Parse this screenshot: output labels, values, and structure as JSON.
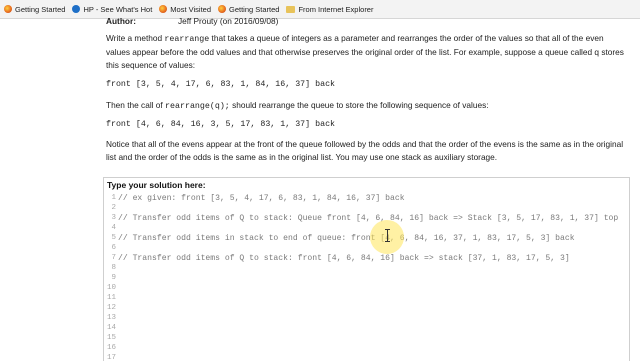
{
  "bookmarks": [
    {
      "label": "Getting Started",
      "icon": "firefox-icon"
    },
    {
      "label": "HP - See What's Hot",
      "icon": "hp-icon"
    },
    {
      "label": "Most Visited",
      "icon": "most-visited-icon"
    },
    {
      "label": "Getting Started",
      "icon": "firefox-icon"
    },
    {
      "label": "From Internet Explorer",
      "icon": "folder-icon"
    }
  ],
  "author": {
    "label": "Author:",
    "value": "Jeff Prouty (on 2016/09/08)"
  },
  "problem": {
    "p1_a": "Write a method ",
    "p1_code": "rearrange",
    "p1_b": " that takes a queue of integers as a parameter and rearranges the order of the values so that all of the even values appear before the odd values and that otherwise preserves the original order of the list. For example, suppose a queue called q stores this sequence of values:",
    "example1": "front [3, 5, 4, 17, 6, 83, 1, 84, 16, 37] back",
    "p2_a": "Then the call of ",
    "p2_code": "rearrange(q);",
    "p2_b": " should rearrange the queue to store the following sequence of values:",
    "example2": "front [4, 6, 84, 16, 3, 5, 17, 83, 1, 37] back",
    "p3": "Notice that all of the evens appear at the front of the queue followed by the odds and that the order of the evens is the same as in the original list and the order of the odds is the same as in the original list. You may use one stack as auxiliary storage."
  },
  "editor": {
    "title": "Type your solution here:",
    "lines": [
      {
        "n": "1",
        "text": "// ex given: front [3, 5, 4, 17, 6, 83, 1, 84, 16, 37] back"
      },
      {
        "n": "2",
        "text": ""
      },
      {
        "n": "3",
        "text": "// Transfer odd items of Q to stack: Queue front [4, 6, 84, 16] back => Stack [3, 5, 17, 83, 1, 37] top"
      },
      {
        "n": "4",
        "text": ""
      },
      {
        "n": "5",
        "text": "// Transfer odd items in stack to end of queue: front [4, 6, 84, 16, 37, 1, 83, 17, 5, 3] back"
      },
      {
        "n": "6",
        "text": ""
      },
      {
        "n": "7",
        "text": "// Transfer odd items of Q to stack: front [4, 6, 84, 16] back => stack [37, 1, 83, 17, 5, 3]"
      },
      {
        "n": "8",
        "text": ""
      },
      {
        "n": "9",
        "text": ""
      },
      {
        "n": "10",
        "text": ""
      },
      {
        "n": "11",
        "text": ""
      },
      {
        "n": "12",
        "text": ""
      },
      {
        "n": "13",
        "text": ""
      },
      {
        "n": "14",
        "text": ""
      },
      {
        "n": "15",
        "text": ""
      },
      {
        "n": "16",
        "text": ""
      },
      {
        "n": "17",
        "text": ""
      }
    ]
  }
}
